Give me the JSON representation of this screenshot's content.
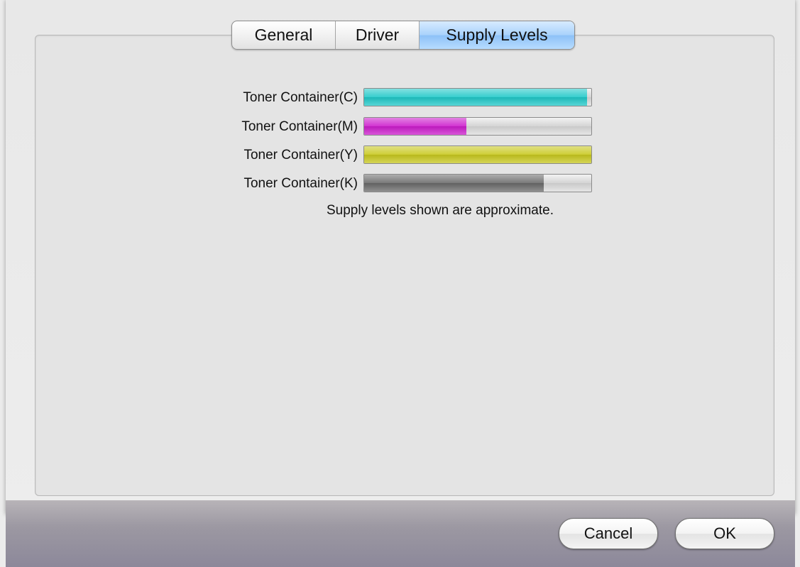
{
  "tabs": [
    {
      "label": "General",
      "selected": false
    },
    {
      "label": "Driver",
      "selected": false
    },
    {
      "label": "Supply Levels",
      "selected": true
    }
  ],
  "supplies": [
    {
      "label": "Toner Container(C)",
      "level_percent": 98,
      "color": "#1fc8c8"
    },
    {
      "label": "Toner Container(M)",
      "level_percent": 45,
      "color": "#cc1ccc"
    },
    {
      "label": "Toner Container(Y)",
      "level_percent": 100,
      "color": "#c8c81e"
    },
    {
      "label": "Toner Container(K)",
      "level_percent": 79,
      "color": "#6a6a6a"
    }
  ],
  "note": "Supply levels shown are approximate.",
  "buttons": {
    "cancel": "Cancel",
    "ok": "OK"
  }
}
